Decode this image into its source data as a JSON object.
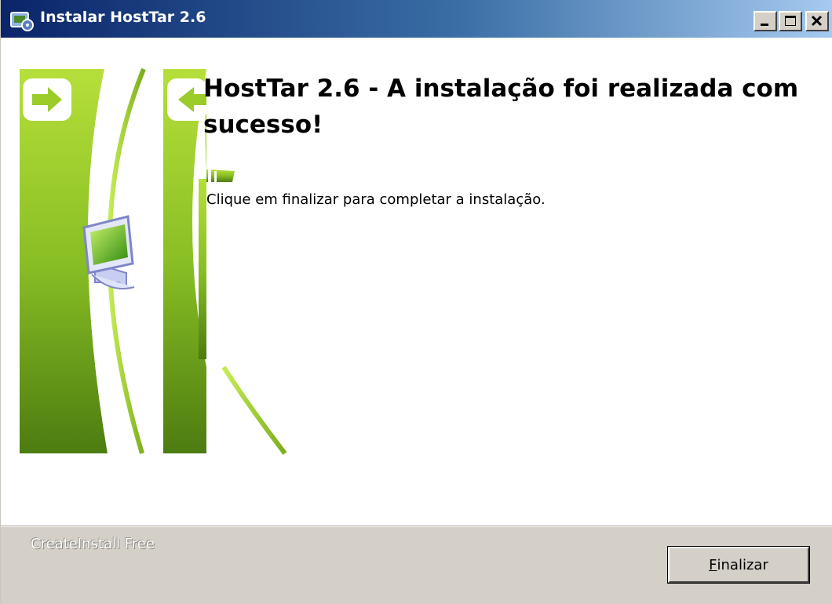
{
  "window": {
    "title": "Instalar HostTar 2.6",
    "controls": {
      "minimize_icon": "minimize-icon",
      "maximize_icon": "maximize-icon",
      "close_icon": "close-icon"
    }
  },
  "main": {
    "heading": "HostTar 2.6 - A instalação foi realizada com sucesso!",
    "instruction": "Clique em finalizar para completar a instalação."
  },
  "footer": {
    "brand": "CreateInstall Free",
    "finish_mnemonic": "F",
    "finish_rest": "inalizar"
  },
  "colors": {
    "titlebar_start": "#0a246a",
    "titlebar_end": "#a6caf0",
    "graphic_green_light": "#b6df3a",
    "graphic_green_dark": "#4c7c10",
    "dialog_face": "#d4d0c8"
  },
  "icons": [
    "installer-app-icon",
    "arrow-right-icon",
    "arrow-left-icon",
    "computer-monitor-icon"
  ]
}
